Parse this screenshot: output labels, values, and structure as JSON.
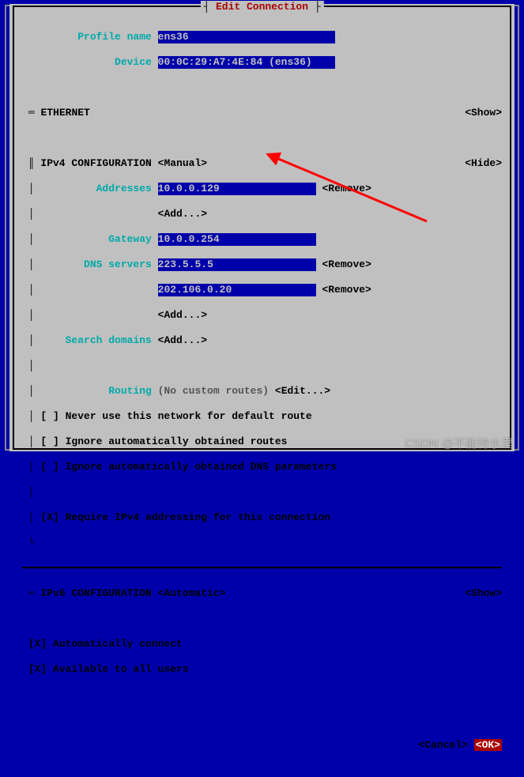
{
  "dialog": {
    "title_decoration_open": "┤",
    "title_text": " Edit Connection ",
    "title_decoration_close": "├"
  },
  "profile": {
    "name_label": "Profile name",
    "name_value": "ens36",
    "device_label": "Device",
    "device_value": "00:0C:29:A7:4E:84 (ens36)"
  },
  "ethernet": {
    "marker": "═",
    "heading": "ETHERNET",
    "toggle": "<Show>"
  },
  "ipv4": {
    "heading": "IPv4 CONFIGURATION",
    "mode": "<Manual>",
    "toggle": "<Hide>",
    "addresses_label": "Addresses",
    "address0": "10.0.0.129",
    "address0_remove": "<Remove>",
    "add0": "<Add...>",
    "gateway_label": "Gateway",
    "gateway_value": "10.0.0.254",
    "dns_label": "DNS servers",
    "dns0": "223.5.5.5",
    "dns0_remove": "<Remove>",
    "dns1": "202.106.0.20",
    "dns1_remove": "<Remove>",
    "dns_add": "<Add...>",
    "search_label": "Search domains",
    "search_add": "<Add...>",
    "routing_label": "Routing",
    "routing_summary": "(No custom routes)",
    "routing_edit": "<Edit...>",
    "cb_never_default": "[ ] Never use this network for default route",
    "cb_ignore_routes": "[ ] Ignore automatically obtained routes",
    "cb_ignore_dns": "[ ] Ignore automatically obtained DNS parameters",
    "cb_require": "[X] Require IPv4 addressing for this connection"
  },
  "ipv6": {
    "marker": "═",
    "heading": "IPv6 CONFIGURATION",
    "mode": "<Automatic>",
    "toggle": "<Show>"
  },
  "global": {
    "auto_connect": "[X] Automatically connect",
    "avail_all": "[X] Available to all users"
  },
  "footer": {
    "cancel": "<Cancel>",
    "ok": "<OK>"
  },
  "watermark": "CSDN @不能待水里"
}
